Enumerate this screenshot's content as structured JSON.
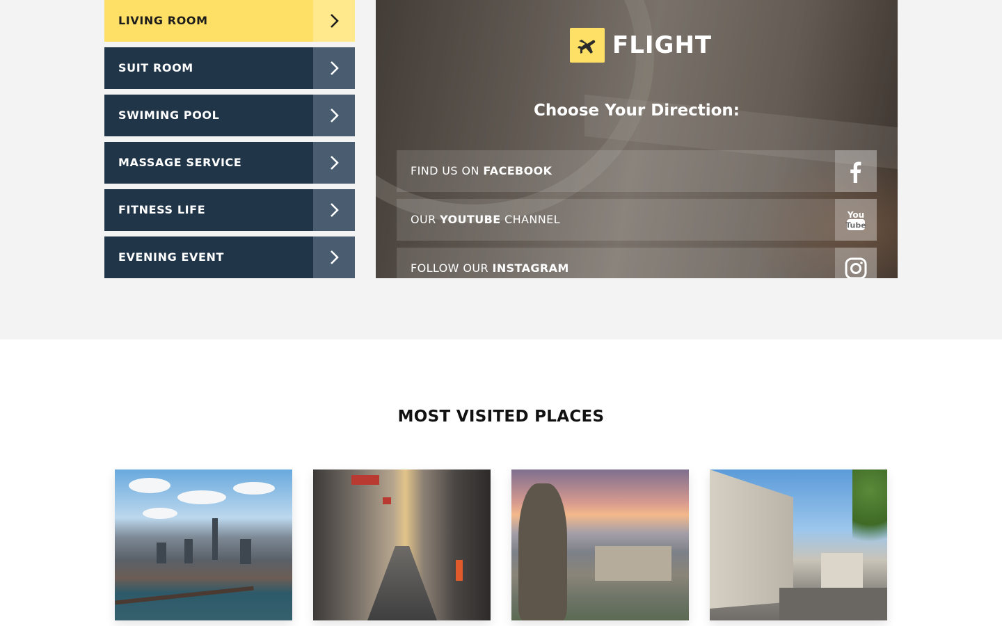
{
  "menu": {
    "items": [
      {
        "label": "LIVING ROOM",
        "active": true
      },
      {
        "label": "SUIT ROOM",
        "active": false
      },
      {
        "label": "SWIMING POOL",
        "active": false
      },
      {
        "label": "MASSAGE SERVICE",
        "active": false
      },
      {
        "label": "FITNESS LIFE",
        "active": false
      },
      {
        "label": "EVENING EVENT",
        "active": false
      }
    ],
    "arrow_icon": "chevron-right-icon"
  },
  "hero": {
    "logo_text": "FLIGHT",
    "logo_icon": "airplane-icon",
    "title": "Choose Your Direction:",
    "social": [
      {
        "prefix": "FIND US ON ",
        "bold": "FACEBOOK",
        "suffix": "",
        "icon": "facebook-icon"
      },
      {
        "prefix": "OUR ",
        "bold": "YOUTUBE",
        "suffix": " CHANNEL",
        "icon": "youtube-icon"
      },
      {
        "prefix": "FOLLOW OUR ",
        "bold": "INSTAGRAM",
        "suffix": "",
        "icon": "instagram-icon"
      }
    ]
  },
  "places": {
    "title": "MOST VISITED PLACES"
  },
  "colors": {
    "accent": "#ffe066",
    "menu_bg": "#213549",
    "menu_arrow_bg": "#4a5d70",
    "section_bg": "#f3f3f3"
  }
}
